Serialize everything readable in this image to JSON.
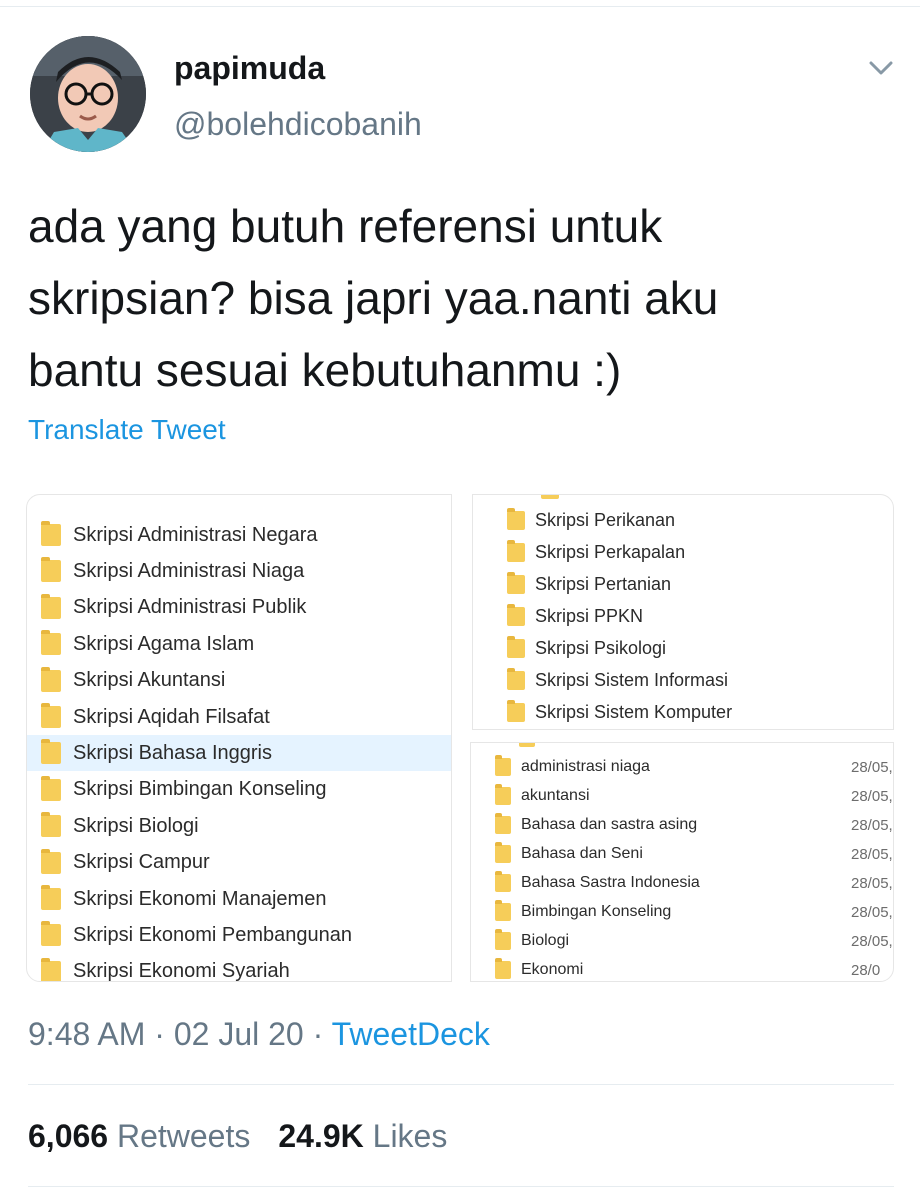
{
  "tweet": {
    "display_name": "papimuda",
    "handle": "@bolehdicobanih",
    "text_lines": [
      "ada yang butuh referensi untuk",
      "skripsian? bisa japri yaa.nanti aku",
      "bantu sesuai kebutuhanmu :)"
    ],
    "translate_label": "Translate Tweet",
    "time": "9:48 AM",
    "separator": " · ",
    "date": "02 Jul 20",
    "source": "TweetDeck",
    "retweets_count": "6,066",
    "retweets_label": "Retweets",
    "likes_count": "24.9K",
    "likes_label": "Likes"
  },
  "media": {
    "left_folders": [
      "Skripsi Administrasi Negara",
      "Skripsi Administrasi Niaga",
      "Skripsi Administrasi Publik",
      "Skripsi Agama Islam",
      "Skripsi Akuntansi",
      "Skripsi Aqidah Filsafat",
      "Skripsi Bahasa Inggris",
      "Skripsi Bimbingan Konseling",
      "Skripsi Biologi",
      "Skripsi Campur",
      "Skripsi Ekonomi Manajemen",
      "Skripsi Ekonomi Pembangunan",
      "Skripsi Ekonomi Syariah"
    ],
    "left_selected_index": 6,
    "right_top_folders": [
      "Skripsi Perikanan",
      "Skripsi Perkapalan",
      "Skripsi Pertanian",
      "Skripsi PPKN",
      "Skripsi Psikologi",
      "Skripsi Sistem Informasi",
      "Skripsi Sistem Komputer"
    ],
    "right_bottom_folders": [
      {
        "name": "administrasi niaga",
        "date": "28/05,"
      },
      {
        "name": "akuntansi",
        "date": "28/05,"
      },
      {
        "name": "Bahasa dan sastra asing",
        "date": "28/05,"
      },
      {
        "name": "Bahasa dan Seni",
        "date": "28/05,"
      },
      {
        "name": "Bahasa Sastra Indonesia",
        "date": "28/05,"
      },
      {
        "name": "Bimbingan Konseling",
        "date": "28/05,"
      },
      {
        "name": "Biologi",
        "date": "28/05,"
      },
      {
        "name": "Ekonomi",
        "date": "28/0"
      }
    ]
  },
  "colors": {
    "link": "#1b95e0",
    "secondary_text": "#657786",
    "folder": "#f6cd59",
    "selection": "#e5f3ff"
  },
  "icons": {
    "avatar": "cartoon-avatar-with-glasses",
    "caret": "chevron-down-icon",
    "folder": "folder-icon"
  }
}
